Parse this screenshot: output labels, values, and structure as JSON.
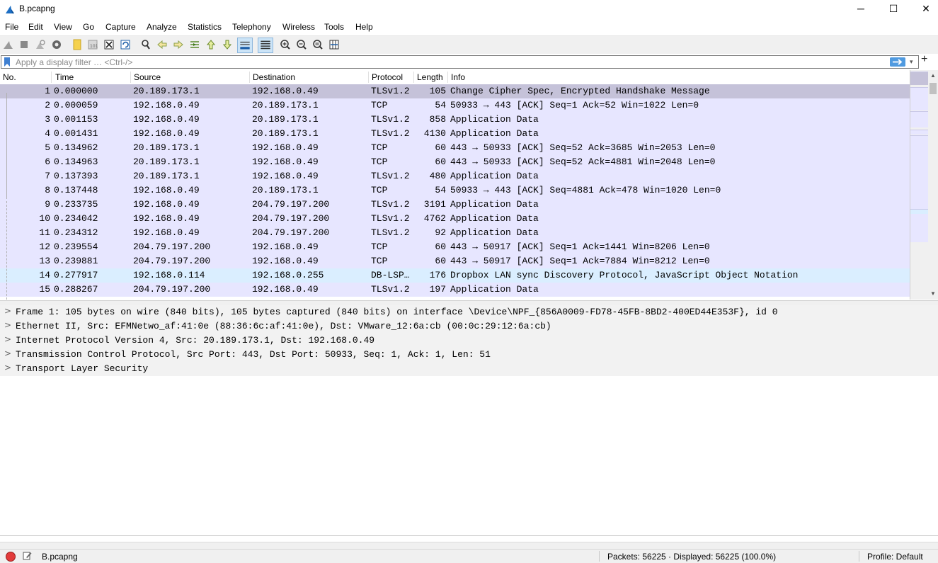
{
  "window": {
    "title": "B.pcapng",
    "min": "─",
    "max": "☐",
    "close": "✕"
  },
  "menu": [
    "File",
    "Edit",
    "View",
    "Go",
    "Capture",
    "Analyze",
    "Statistics",
    "Telephony",
    "Wireless",
    "Tools",
    "Help"
  ],
  "filter": {
    "placeholder": "Apply a display filter … <Ctrl-/>",
    "value": "",
    "add_label": "+",
    "dropdown": "▾"
  },
  "packet_list": {
    "columns": [
      "No.",
      "Time",
      "Source",
      "Destination",
      "Protocol",
      "Length",
      "Info"
    ],
    "rows": [
      {
        "no": "1",
        "time": "0.000000",
        "src": "20.189.173.1",
        "dst": "192.168.0.49",
        "proto": "TLSv1.2",
        "len": "105",
        "info": "Change Cipher Spec, Encrypted Handshake Message"
      },
      {
        "no": "2",
        "time": "0.000059",
        "src": "192.168.0.49",
        "dst": "20.189.173.1",
        "proto": "TCP",
        "len": "54",
        "info": "50933 → 443 [ACK] Seq=1 Ack=52 Win=1022 Len=0"
      },
      {
        "no": "3",
        "time": "0.001153",
        "src": "192.168.0.49",
        "dst": "20.189.173.1",
        "proto": "TLSv1.2",
        "len": "858",
        "info": "Application Data"
      },
      {
        "no": "4",
        "time": "0.001431",
        "src": "192.168.0.49",
        "dst": "20.189.173.1",
        "proto": "TLSv1.2",
        "len": "4130",
        "info": "Application Data"
      },
      {
        "no": "5",
        "time": "0.134962",
        "src": "20.189.173.1",
        "dst": "192.168.0.49",
        "proto": "TCP",
        "len": "60",
        "info": "443 → 50933 [ACK] Seq=52 Ack=3685 Win=2053 Len=0"
      },
      {
        "no": "6",
        "time": "0.134963",
        "src": "20.189.173.1",
        "dst": "192.168.0.49",
        "proto": "TCP",
        "len": "60",
        "info": "443 → 50933 [ACK] Seq=52 Ack=4881 Win=2048 Len=0"
      },
      {
        "no": "7",
        "time": "0.137393",
        "src": "20.189.173.1",
        "dst": "192.168.0.49",
        "proto": "TLSv1.2",
        "len": "480",
        "info": "Application Data"
      },
      {
        "no": "8",
        "time": "0.137448",
        "src": "192.168.0.49",
        "dst": "20.189.173.1",
        "proto": "TCP",
        "len": "54",
        "info": "50933 → 443 [ACK] Seq=4881 Ack=478 Win=1020 Len=0"
      },
      {
        "no": "9",
        "time": "0.233735",
        "src": "192.168.0.49",
        "dst": "204.79.197.200",
        "proto": "TLSv1.2",
        "len": "3191",
        "info": "Application Data"
      },
      {
        "no": "10",
        "time": "0.234042",
        "src": "192.168.0.49",
        "dst": "204.79.197.200",
        "proto": "TLSv1.2",
        "len": "4762",
        "info": "Application Data"
      },
      {
        "no": "11",
        "time": "0.234312",
        "src": "192.168.0.49",
        "dst": "204.79.197.200",
        "proto": "TLSv1.2",
        "len": "92",
        "info": "Application Data"
      },
      {
        "no": "12",
        "time": "0.239554",
        "src": "204.79.197.200",
        "dst": "192.168.0.49",
        "proto": "TCP",
        "len": "60",
        "info": "443 → 50917 [ACK] Seq=1 Ack=1441 Win=8206 Len=0"
      },
      {
        "no": "13",
        "time": "0.239881",
        "src": "204.79.197.200",
        "dst": "192.168.0.49",
        "proto": "TCP",
        "len": "60",
        "info": "443 → 50917 [ACK] Seq=1 Ack=7884 Win=8212 Len=0"
      },
      {
        "no": "14",
        "time": "0.277917",
        "src": "192.168.0.114",
        "dst": "192.168.0.255",
        "proto": "DB-LSP…",
        "len": "176",
        "info": "Dropbox LAN sync Discovery Protocol, JavaScript Object Notation"
      },
      {
        "no": "15",
        "time": "0.288267",
        "src": "204.79.197.200",
        "dst": "192.168.0.49",
        "proto": "TLSv1.2",
        "len": "197",
        "info": "Application Data"
      }
    ]
  },
  "details": [
    "Frame 1: 105 bytes on wire (840 bits), 105 bytes captured (840 bits) on interface \\Device\\NPF_{856A0009-FD78-45FB-8BD2-400ED44E353F}, id 0",
    "Ethernet II, Src: EFMNetwo_af:41:0e (88:36:6c:af:41:0e), Dst: VMware_12:6a:cb (00:0c:29:12:6a:cb)",
    "Internet Protocol Version 4, Src: 20.189.173.1, Dst: 192.168.0.49",
    "Transmission Control Protocol, Src Port: 443, Dst Port: 50933, Seq: 1, Ack: 1, Len: 51",
    "Transport Layer Security"
  ],
  "details_chevron": ">",
  "status": {
    "file": "B.pcapng",
    "packets": "Packets: 56225 · Displayed: 56225 (100.0%)",
    "profile": "Profile: Default"
  },
  "colors": {
    "row_tcp": "#e7e6ff",
    "row_selected": "#c5c2d9",
    "row_udp": "#daeeff",
    "accent": "#4f9ae0"
  },
  "icons": [
    "wireshark-fin-icon",
    "start-capture-icon",
    "stop-capture-icon",
    "restart-capture-icon",
    "capture-options-icon",
    "open-file-icon",
    "save-file-icon",
    "close-file-icon",
    "reload-file-icon",
    "find-packet-icon",
    "go-back-icon",
    "go-forward-icon",
    "go-to-packet-icon",
    "go-first-icon",
    "go-last-icon",
    "autoscroll-icon",
    "colorize-icon",
    "zoom-in-icon",
    "zoom-out-icon",
    "zoom-normal-icon",
    "resize-columns-icon",
    "bookmark-icon",
    "apply-filter-icon"
  ]
}
